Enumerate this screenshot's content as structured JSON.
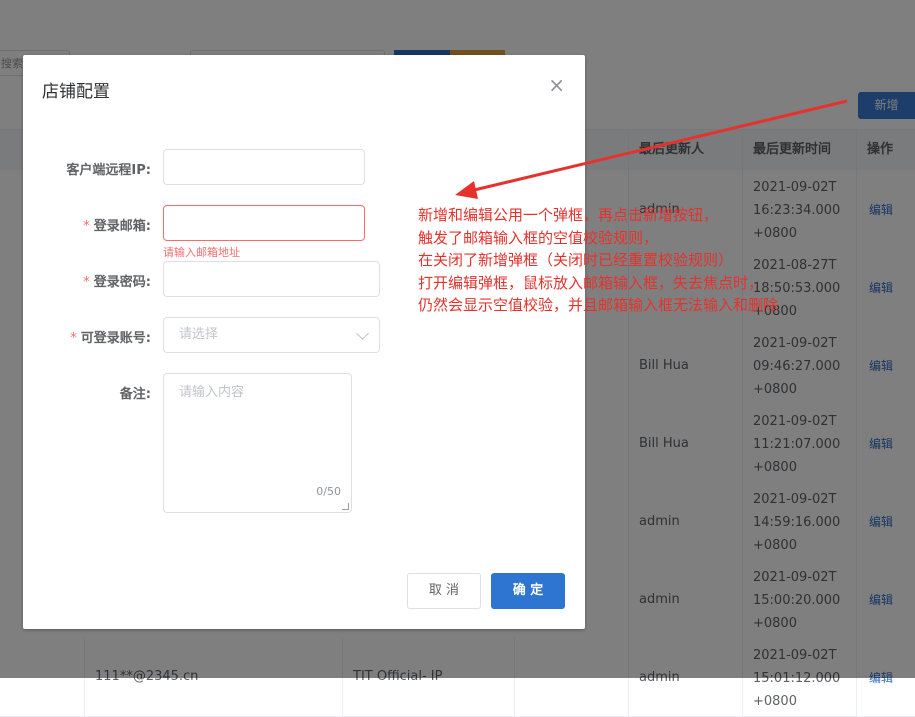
{
  "background": {
    "search_placeholder": "搜索",
    "add_button": "新增",
    "columns": {
      "last_updater": "最后更新人",
      "last_updated_time": "最后更新时间",
      "actions": "操作"
    },
    "rows": [
      {
        "updater": "admin",
        "time": "2021-09-02T16:23:34.000+0800",
        "action": "编辑"
      },
      {
        "updater": "",
        "time": "2021-08-27T18:50:53.000+0800",
        "action": "编辑"
      },
      {
        "updater": "Bill Hua",
        "time": "2021-09-02T09:46:27.000+0800",
        "action": "编辑"
      },
      {
        "updater": "Bill Hua",
        "time": "2021-09-02T11:21:07.000+0800",
        "action": "编辑"
      },
      {
        "updater": "admin",
        "time": "2021-09-02T14:59:16.000+0800",
        "action": "编辑"
      },
      {
        "updater": "admin",
        "time": "2021-09-02T15:00:20.000+0800",
        "action": "编辑"
      },
      {
        "email": "111**@2345.cn",
        "shop": "TIT Official- IP",
        "updater": "admin",
        "time": "2021-09-02T15:01:12.000+0800",
        "action": "编辑"
      }
    ]
  },
  "dialog": {
    "title": "店铺配置",
    "close_icon": "×",
    "fields": {
      "ip_label": "客户端远程IP:",
      "email_label": "登录邮箱:",
      "email_error": "请输入邮箱地址",
      "password_label": "登录密码:",
      "account_label": "可登录账号:",
      "account_placeholder": "请选择",
      "remark_label": "备注:",
      "remark_placeholder": "请输入内容",
      "remark_counter": "0/50",
      "required_mark": "*"
    },
    "buttons": {
      "cancel": "取 消",
      "confirm": "确 定"
    }
  },
  "annotation": {
    "lines": [
      "新增和编辑公用一个弹框，再点击新增按钮，",
      "触发了邮箱输入框的空值校验规则，",
      "在关闭了新增弹框（关闭时已经重置校验规则）",
      "打开编辑弹框，鼠标放入邮箱输入框，失去焦点时，",
      "仍然会显示空值校验，并且邮箱输入框无法输入和删除"
    ],
    "color": "#e5322d"
  }
}
